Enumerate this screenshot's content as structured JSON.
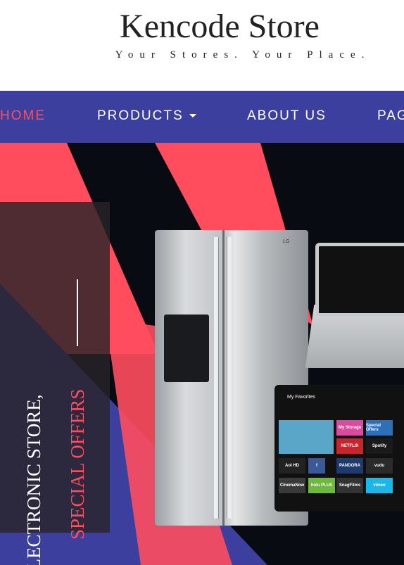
{
  "header": {
    "brand": "Kencode Store",
    "tagline": "Your Stores. Your Place."
  },
  "nav": {
    "items": [
      {
        "label": "HOME",
        "active": true
      },
      {
        "label": "PRODUCTS",
        "has_dropdown": true
      },
      {
        "label": "ABOUT US"
      },
      {
        "label": "PAG"
      }
    ]
  },
  "hero": {
    "line1": "ELECTRONIC STORE,",
    "line2": "SPECIAL OFFERS",
    "fridge_logo": "LG",
    "tv": {
      "title": "My Favorites",
      "tiles": [
        "My Storage",
        "Special Offers",
        "NETFLIX",
        "Spotify",
        "Aol HD",
        "f",
        "PANDORA",
        "vudu",
        "CinemaNow",
        "hulu PLUS",
        "SnagFilms",
        "vimeo"
      ]
    }
  },
  "colors": {
    "nav_bg": "#3d3f9e",
    "accent": "#ff4d5e",
    "hero_bg": "#090b12"
  }
}
